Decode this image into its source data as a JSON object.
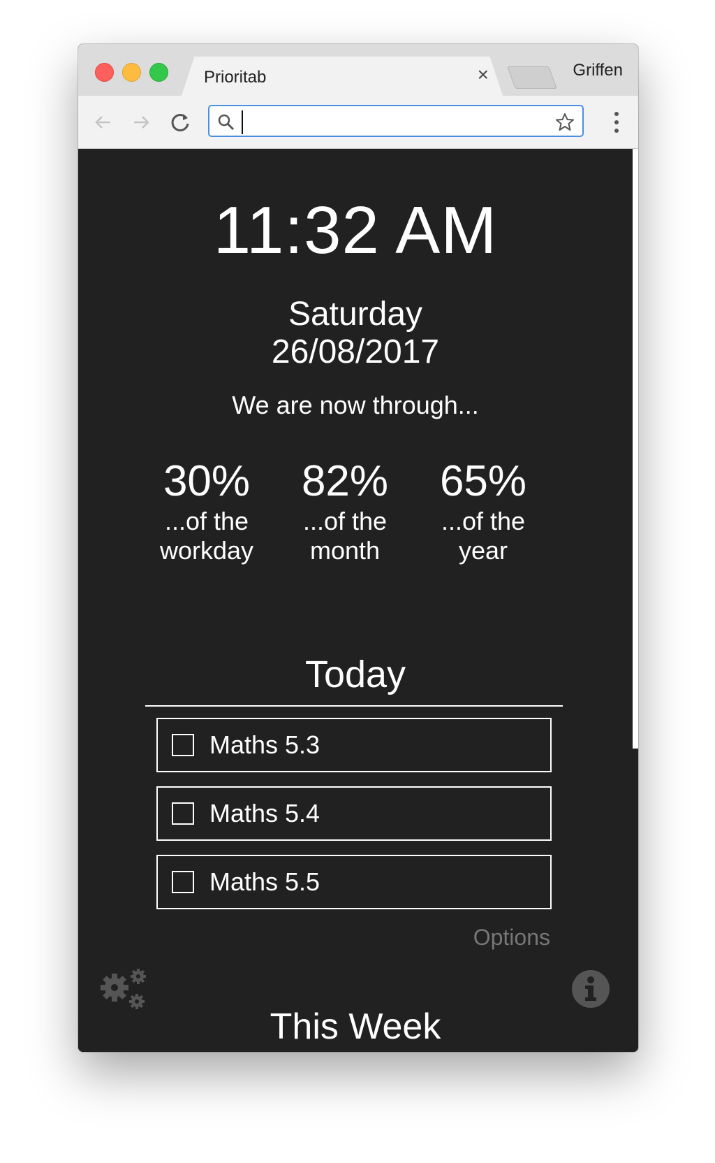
{
  "browser": {
    "tab_title": "Prioritab",
    "tab_close": "×",
    "profile_name": "Griffen",
    "address_value": "",
    "icons": [
      "back-arrow-icon",
      "forward-arrow-icon",
      "reload-icon",
      "search-icon",
      "star-icon",
      "menu-dots-icon"
    ]
  },
  "clock": {
    "time": "11:32 AM"
  },
  "date": {
    "day": "Saturday",
    "date": "26/08/2017"
  },
  "progress": {
    "heading": "We are now through...",
    "items": [
      {
        "value": "30%",
        "line1": "...of the",
        "line2": "workday"
      },
      {
        "value": "82%",
        "line1": "...of the",
        "line2": "month"
      },
      {
        "value": "65%",
        "line1": "...of the",
        "line2": "year"
      }
    ]
  },
  "today": {
    "title": "Today",
    "tasks": [
      {
        "label": "Maths 5.3",
        "checked": false
      },
      {
        "label": "Maths 5.4",
        "checked": false
      },
      {
        "label": "Maths 5.5",
        "checked": false
      }
    ],
    "options_label": "Options"
  },
  "week": {
    "title": "This Week"
  },
  "icons": {
    "settings": "gears-icon",
    "info": "info-icon"
  },
  "colors": {
    "background": "#212121",
    "text": "#ffffff",
    "muted": "#777777",
    "accent": "#4a90e2"
  }
}
